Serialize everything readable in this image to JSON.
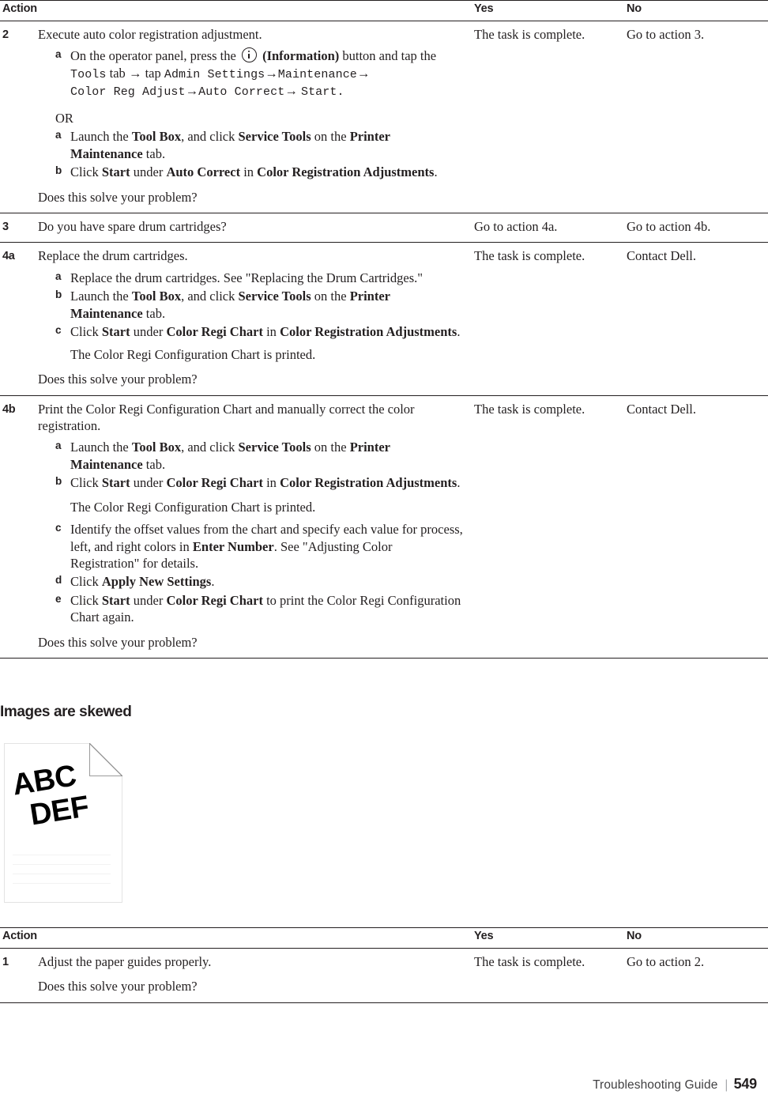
{
  "table_top": {
    "columns": [
      "Action",
      "Yes",
      "No"
    ],
    "rows": [
      {
        "num": "2",
        "lead": "Execute auto color registration adjustment.",
        "steps_1": [
          {
            "marker": "a",
            "parts": [
              {
                "t": "On the operator panel, press the ",
                "s": "plain"
              },
              {
                "t": "info-icon",
                "s": "icon"
              },
              {
                "t": "(Information)",
                "s": "bold"
              },
              {
                "t": " button and tap the ",
                "s": "plain"
              },
              {
                "t": "Tools",
                "s": "mono"
              },
              {
                "t": " tab ",
                "s": "plain"
              },
              {
                "t": "→",
                "s": "arrow"
              },
              {
                "t": " tap ",
                "s": "plain"
              },
              {
                "t": "Admin Settings",
                "s": "mono"
              },
              {
                "t": "→",
                "s": "arrow"
              },
              {
                "t": "Maintenance",
                "s": "mono"
              },
              {
                "t": "→",
                "s": "arrow"
              },
              {
                "t": "Color Reg Adjust",
                "s": "mono"
              },
              {
                "t": "→",
                "s": "arrow"
              },
              {
                "t": "Auto Correct",
                "s": "mono"
              },
              {
                "t": "→",
                "s": "arrow"
              },
              {
                "t": " Start.",
                "s": "mono"
              }
            ]
          }
        ],
        "or_label": "OR",
        "steps_2": [
          {
            "marker": "a",
            "parts": [
              {
                "t": "Launch the ",
                "s": "plain"
              },
              {
                "t": "Tool Box",
                "s": "bold"
              },
              {
                "t": ", and click ",
                "s": "plain"
              },
              {
                "t": "Service Tools",
                "s": "bold"
              },
              {
                "t": " on the ",
                "s": "plain"
              },
              {
                "t": "Printer Maintenance",
                "s": "bold"
              },
              {
                "t": " tab.",
                "s": "plain"
              }
            ]
          },
          {
            "marker": "b",
            "parts": [
              {
                "t": "Click ",
                "s": "plain"
              },
              {
                "t": "Start",
                "s": "bold"
              },
              {
                "t": " under ",
                "s": "plain"
              },
              {
                "t": "Auto Correct",
                "s": "bold"
              },
              {
                "t": " in ",
                "s": "plain"
              },
              {
                "t": "Color Registration Adjustments",
                "s": "bold"
              },
              {
                "t": ".",
                "s": "plain"
              }
            ]
          }
        ],
        "question": "Does this solve your problem?",
        "yes": "The task is complete.",
        "no": "Go to action 3."
      },
      {
        "num": "3",
        "lead": "Do you have spare drum cartridges?",
        "yes": "Go to action 4a.",
        "no": "Go to action 4b."
      },
      {
        "num": "4a",
        "lead": "Replace the drum cartridges.",
        "steps_1": [
          {
            "marker": "a",
            "parts": [
              {
                "t": "Replace the drum cartridges. See \"Replacing the Drum Cartridges.\"",
                "s": "plain"
              }
            ]
          },
          {
            "marker": "b",
            "parts": [
              {
                "t": "Launch the ",
                "s": "plain"
              },
              {
                "t": "Tool Box",
                "s": "bold"
              },
              {
                "t": ", and click ",
                "s": "plain"
              },
              {
                "t": "Service Tools",
                "s": "bold"
              },
              {
                "t": " on the ",
                "s": "plain"
              },
              {
                "t": "Printer Maintenance",
                "s": "bold"
              },
              {
                "t": " tab.",
                "s": "plain"
              }
            ]
          },
          {
            "marker": "c",
            "parts": [
              {
                "t": "Click ",
                "s": "plain"
              },
              {
                "t": "Start",
                "s": "bold"
              },
              {
                "t": " under ",
                "s": "plain"
              },
              {
                "t": "Color Regi Chart",
                "s": "bold"
              },
              {
                "t": " in ",
                "s": "plain"
              },
              {
                "t": "Color Registration Adjustments",
                "s": "bold"
              },
              {
                "t": ".",
                "s": "plain"
              }
            ]
          }
        ],
        "note": "The Color Regi Configuration Chart is printed.",
        "question": "Does this solve your problem?",
        "yes": "The task is complete.",
        "no": "Contact Dell."
      },
      {
        "num": "4b",
        "lead": "Print the Color Regi Configuration Chart and manually correct the color registration.",
        "steps_1": [
          {
            "marker": "a",
            "parts": [
              {
                "t": "Launch the ",
                "s": "plain"
              },
              {
                "t": "Tool Box",
                "s": "bold"
              },
              {
                "t": ", and click ",
                "s": "plain"
              },
              {
                "t": "Service Tools",
                "s": "bold"
              },
              {
                "t": " on the ",
                "s": "plain"
              },
              {
                "t": "Printer Maintenance",
                "s": "bold"
              },
              {
                "t": " tab.",
                "s": "plain"
              }
            ]
          },
          {
            "marker": "b",
            "parts": [
              {
                "t": "Click ",
                "s": "plain"
              },
              {
                "t": "Start",
                "s": "bold"
              },
              {
                "t": " under ",
                "s": "plain"
              },
              {
                "t": "Color Regi Chart",
                "s": "bold"
              },
              {
                "t": " in ",
                "s": "plain"
              },
              {
                "t": "Color Registration Adjustments",
                "s": "bold"
              },
              {
                "t": ".",
                "s": "plain"
              }
            ]
          },
          {
            "marker": "note",
            "parts": [
              {
                "t": "The Color Regi Configuration Chart is printed.",
                "s": "plain"
              }
            ]
          },
          {
            "marker": "c",
            "parts": [
              {
                "t": "Identify the offset values from the chart and specify each value for process, left, and right colors in ",
                "s": "plain"
              },
              {
                "t": "Enter Number",
                "s": "bold"
              },
              {
                "t": ". See \"Adjusting Color Registration\" for details.",
                "s": "plain"
              }
            ]
          },
          {
            "marker": "d",
            "parts": [
              {
                "t": "Click ",
                "s": "plain"
              },
              {
                "t": "Apply New Settings",
                "s": "bold"
              },
              {
                "t": ".",
                "s": "plain"
              }
            ]
          },
          {
            "marker": "e",
            "parts": [
              {
                "t": "Click ",
                "s": "plain"
              },
              {
                "t": "Start",
                "s": "bold"
              },
              {
                "t": " under ",
                "s": "plain"
              },
              {
                "t": "Color Regi Chart",
                "s": "bold"
              },
              {
                "t": " to print the Color Regi Configuration Chart again.",
                "s": "plain"
              }
            ]
          }
        ],
        "question": "Does this solve your problem?",
        "yes": "The task is complete.",
        "no": "Contact Dell."
      }
    ]
  },
  "section": {
    "heading": "Images are skewed",
    "figure": {
      "line1": "ABC",
      "line2": "DEF",
      "icon": "skewed-page-figure"
    }
  },
  "table_bottom": {
    "columns": [
      "Action",
      "Yes",
      "No"
    ],
    "rows": [
      {
        "num": "1",
        "lead": "Adjust the paper guides properly.",
        "question": "Does this solve your problem?",
        "yes": "The task is complete.",
        "no": "Go to action 2."
      }
    ]
  },
  "footer": {
    "guide": "Troubleshooting Guide",
    "separator": "|",
    "page": "549"
  }
}
